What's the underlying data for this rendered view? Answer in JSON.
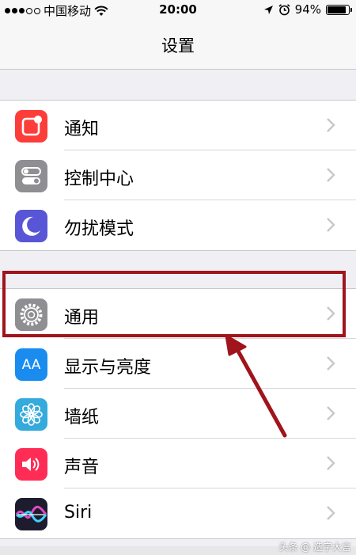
{
  "status_bar": {
    "carrier": "中国移动",
    "time": "20:00",
    "battery_pct": "94%",
    "battery_level": 0.94
  },
  "nav": {
    "title": "设置"
  },
  "groups": [
    {
      "items": [
        {
          "label": "通知",
          "icon": "notifications-icon",
          "color": "#fc3d39"
        },
        {
          "label": "控制中心",
          "icon": "control-center-icon",
          "color": "#8e8e93"
        },
        {
          "label": "勿扰模式",
          "icon": "moon-icon",
          "color": "#5856d6"
        }
      ]
    },
    {
      "items": [
        {
          "label": "通用",
          "icon": "gear-icon",
          "color": "#8e8e93"
        },
        {
          "label": "显示与亮度",
          "icon": "display-brightness-icon",
          "color": "#1a8cf0"
        },
        {
          "label": "墙纸",
          "icon": "wallpaper-icon",
          "color": "#35aadc"
        },
        {
          "label": "声音",
          "icon": "sound-icon",
          "color": "#ff2d55"
        },
        {
          "label": "Siri",
          "icon": "siri-icon",
          "color": "#1c1c2e"
        }
      ]
    }
  ],
  "display_icon_text": "AA",
  "annotation": {
    "highlight_color": "#a0141c",
    "highlight_target": "通用"
  },
  "watermark": {
    "text": "头条 @ 造字大言"
  }
}
